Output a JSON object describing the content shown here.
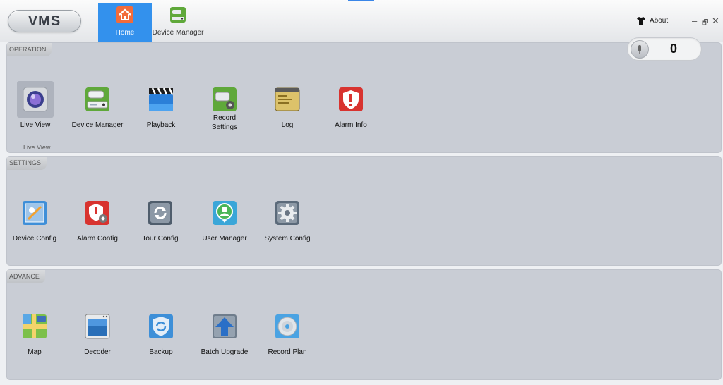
{
  "app": {
    "logo": "VMS"
  },
  "tabs": [
    {
      "label": "Home",
      "icon": "home-icon",
      "active": true
    },
    {
      "label": "Device Manager",
      "icon": "device-manager-icon",
      "active": false
    }
  ],
  "header": {
    "about_label": "About",
    "minimize": "–",
    "restore": "🗗",
    "close": "✕"
  },
  "counter": {
    "value": "0",
    "icon": "microphone-icon"
  },
  "sections": {
    "operation": {
      "title": "OPERATION",
      "hint": "Live View",
      "items": [
        {
          "label": "Live View",
          "icon": "camera-lens-icon"
        },
        {
          "label": "Device Manager",
          "icon": "device-manager-icon"
        },
        {
          "label": "Playback",
          "icon": "clapperboard-icon"
        },
        {
          "label": "Record\nSettings",
          "icon": "record-settings-icon"
        },
        {
          "label": "Log",
          "icon": "log-icon"
        },
        {
          "label": "Alarm Info",
          "icon": "alarm-shield-icon"
        }
      ]
    },
    "settings": {
      "title": "SETTINGS",
      "items": [
        {
          "label": "Device Config",
          "icon": "device-config-icon"
        },
        {
          "label": "Alarm Config",
          "icon": "alarm-config-icon"
        },
        {
          "label": "Tour Config",
          "icon": "tour-refresh-icon"
        },
        {
          "label": "User Manager",
          "icon": "user-icon"
        },
        {
          "label": "System Config",
          "icon": "gear-icon"
        }
      ]
    },
    "advance": {
      "title": "ADVANCE",
      "items": [
        {
          "label": "Map",
          "icon": "map-icon"
        },
        {
          "label": "Decoder",
          "icon": "decoder-icon"
        },
        {
          "label": "Backup",
          "icon": "backup-icon"
        },
        {
          "label": "Batch Upgrade",
          "icon": "upload-arrow-icon"
        },
        {
          "label": "Record Plan",
          "icon": "disc-icon"
        }
      ]
    }
  },
  "colors": {
    "accent": "#3391ed",
    "panel": "#c9cdd5",
    "alarm": "#d8332f"
  }
}
